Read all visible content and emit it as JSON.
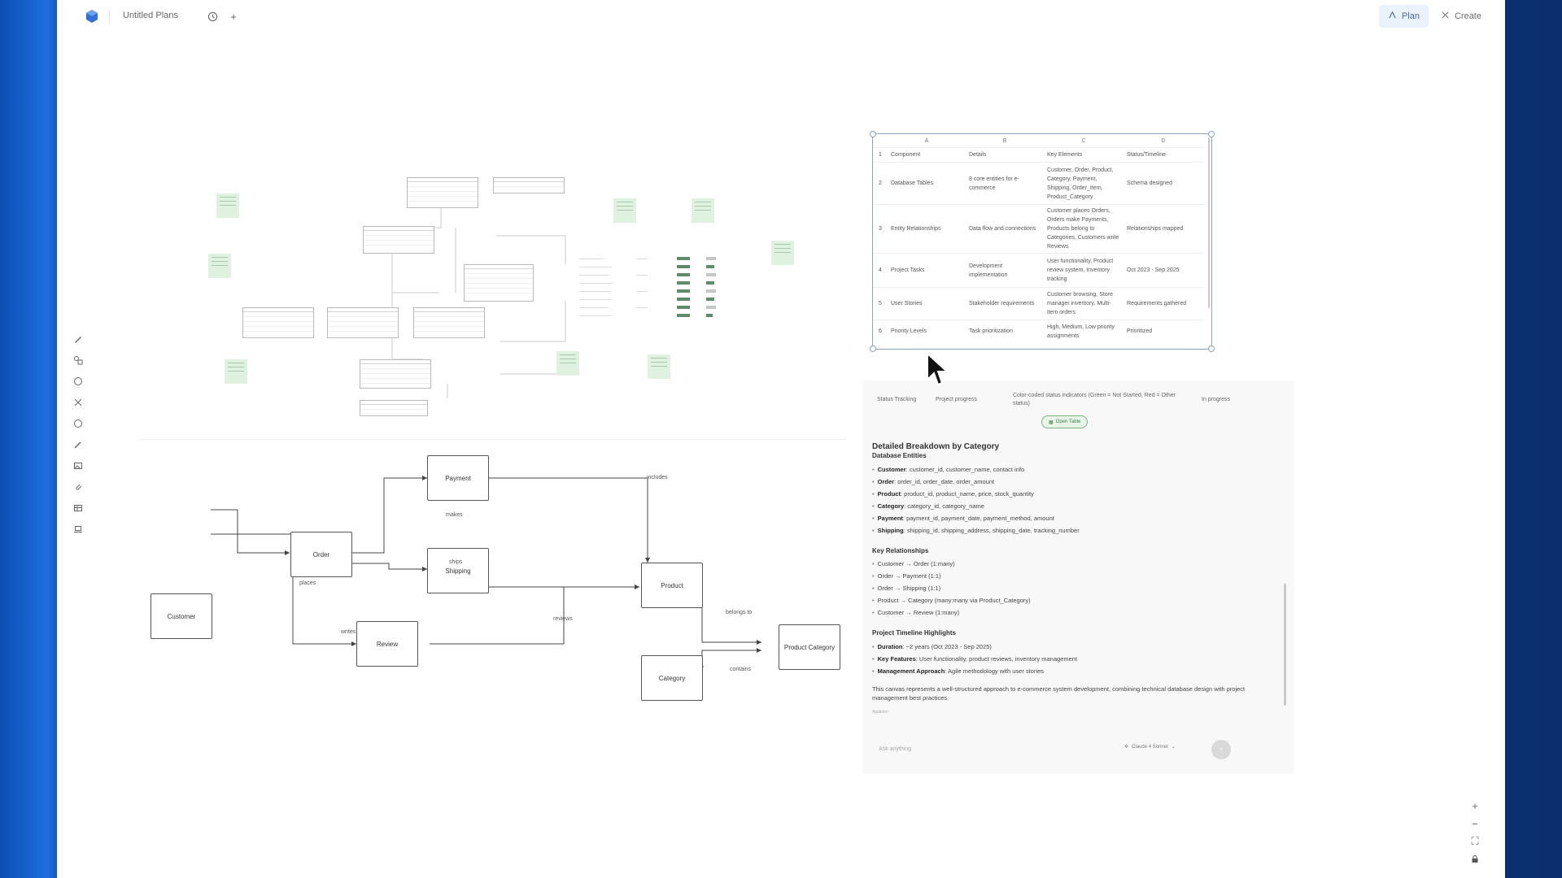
{
  "app": {
    "project_title": "Untitled Plans",
    "modes": [
      {
        "label": "Plan",
        "active": true
      },
      {
        "label": "Create",
        "active": false
      }
    ]
  },
  "flow": {
    "nodes": {
      "payment": "Payment",
      "order": "Order",
      "shipping": "Shipping",
      "product": "Product",
      "customer": "Customer",
      "review": "Review",
      "product_category": "Product Category",
      "category": "Category"
    },
    "edges": {
      "includes": "includes",
      "makes": "makes",
      "ships": "ships",
      "places": "places",
      "writes": "writes",
      "reviews": "reviews",
      "belongs_to": "belongs to",
      "contains": "contains"
    }
  },
  "sheet": {
    "columns": [
      "A",
      "B",
      "C",
      "D"
    ],
    "rows": [
      [
        "1",
        "Component",
        "Details",
        "Key Elements",
        "Status/Timeline"
      ],
      [
        "2",
        "Database Tables",
        "8 core entities for e-commerce",
        "Customer, Order, Product, Category, Payment, Shipping, Order_Item, Product_Category",
        "Schema designed"
      ],
      [
        "3",
        "Entity Relationships",
        "Data flow and connections",
        "Customer places Orders, Orders make Payments, Products belong to Categories, Customers write Reviews",
        "Relationships mapped"
      ],
      [
        "4",
        "Project Tasks",
        "Development implementation",
        "User functionality, Product review system, Inventory tracking",
        "Oct 2023 - Sep 2025"
      ],
      [
        "5",
        "User Stories",
        "Stakeholder requirements",
        "Customer browsing, Store manager inventory, Multi-item orders",
        "Requirements gathered"
      ],
      [
        "6",
        "Priority Levels",
        "Task prioritization",
        "High, Medium, Low priority assignments",
        "Prioritized"
      ]
    ]
  },
  "chat": {
    "partial_row": [
      "Status Tracking",
      "Project progress",
      "Color-coded status indicators (Green = Not Started, Red = Other status)",
      "In progress"
    ],
    "open_table_label": "Open Table",
    "heading": "Detailed Breakdown by Category",
    "entities_title": "Database Entities",
    "entities": [
      {
        "name": "Customer",
        "fields": ": customer_id, customer_name, contact info"
      },
      {
        "name": "Order",
        "fields": ": order_id, order_date, order_amount"
      },
      {
        "name": "Product",
        "fields": ": product_id, product_name, price, stock_quantity"
      },
      {
        "name": "Category",
        "fields": ": category_id, category_name"
      },
      {
        "name": "Payment",
        "fields": ": payment_id, payment_date, payment_method, amount"
      },
      {
        "name": "Shipping",
        "fields": ": shipping_id, shipping_address, shipping_date, tracking_number"
      }
    ],
    "relationships_title": "Key Relationships",
    "relationships": [
      "Customer → Order (1:many)",
      "Order → Payment (1:1)",
      "Order → Shipping (1:1)",
      "Product → Category (many:many via Product_Category)",
      "Customer → Review (1:many)"
    ],
    "timeline_title": "Project Timeline Highlights",
    "timeline": [
      {
        "name": "Duration",
        "text": ": ~2 years (Oct 2023 - Sep 2025)"
      },
      {
        "name": "Key Features",
        "text": ": User functionality, product reviews, inventory management"
      },
      {
        "name": "Management Approach",
        "text": ": Agile methodology with user stories"
      }
    ],
    "summary": "This canvas represents a well-structured approach to e-commerce system development, combining technical database design with project management best practices.",
    "footer_small": "Appleton",
    "input_placeholder": "Ask anything",
    "model_label": "Claude 4 Sonnet"
  }
}
